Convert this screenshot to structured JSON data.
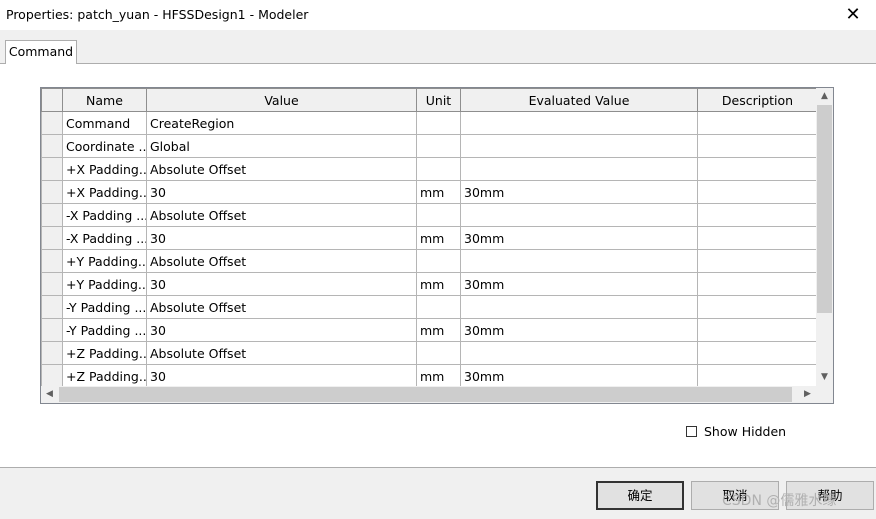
{
  "window": {
    "title": "Properties: patch_yuan - HFSSDesign1 - Modeler",
    "close_glyph": "✕"
  },
  "tabs": [
    {
      "label": "Command"
    }
  ],
  "grid": {
    "columns": [
      "Name",
      "Value",
      "Unit",
      "Evaluated Value",
      "Description"
    ],
    "rows": [
      {
        "name": "Command",
        "value": "CreateRegion",
        "unit": "",
        "evaluated": "",
        "description": ""
      },
      {
        "name": "Coordinate ...",
        "value": "Global",
        "unit": "",
        "evaluated": "",
        "description": ""
      },
      {
        "name": "+X Padding...",
        "value": "Absolute Offset",
        "unit": "",
        "evaluated": "",
        "description": ""
      },
      {
        "name": "+X Padding...",
        "value": "30",
        "unit": "mm",
        "evaluated": "30mm",
        "description": ""
      },
      {
        "name": "-X Padding ...",
        "value": "Absolute Offset",
        "unit": "",
        "evaluated": "",
        "description": ""
      },
      {
        "name": "-X Padding ...",
        "value": "30",
        "unit": "mm",
        "evaluated": "30mm",
        "description": ""
      },
      {
        "name": "+Y Padding...",
        "value": "Absolute Offset",
        "unit": "",
        "evaluated": "",
        "description": ""
      },
      {
        "name": "+Y Padding...",
        "value": "30",
        "unit": "mm",
        "evaluated": "30mm",
        "description": ""
      },
      {
        "name": "-Y Padding ...",
        "value": "Absolute Offset",
        "unit": "",
        "evaluated": "",
        "description": ""
      },
      {
        "name": "-Y Padding ...",
        "value": "30",
        "unit": "mm",
        "evaluated": "30mm",
        "description": ""
      },
      {
        "name": "+Z Padding...",
        "value": "Absolute Offset",
        "unit": "",
        "evaluated": "",
        "description": ""
      },
      {
        "name": "+Z Padding...",
        "value": "30",
        "unit": "mm",
        "evaluated": "30mm",
        "description": ""
      }
    ]
  },
  "scroll_icons": {
    "up": "▲",
    "down": "▼",
    "left": "◀",
    "right": "▶"
  },
  "show_hidden": {
    "label": "Show Hidden",
    "checked": false
  },
  "buttons": {
    "ok": "确定",
    "cancel": "取消",
    "help": "帮助"
  },
  "watermark": "CSDN @儒雅水缘"
}
